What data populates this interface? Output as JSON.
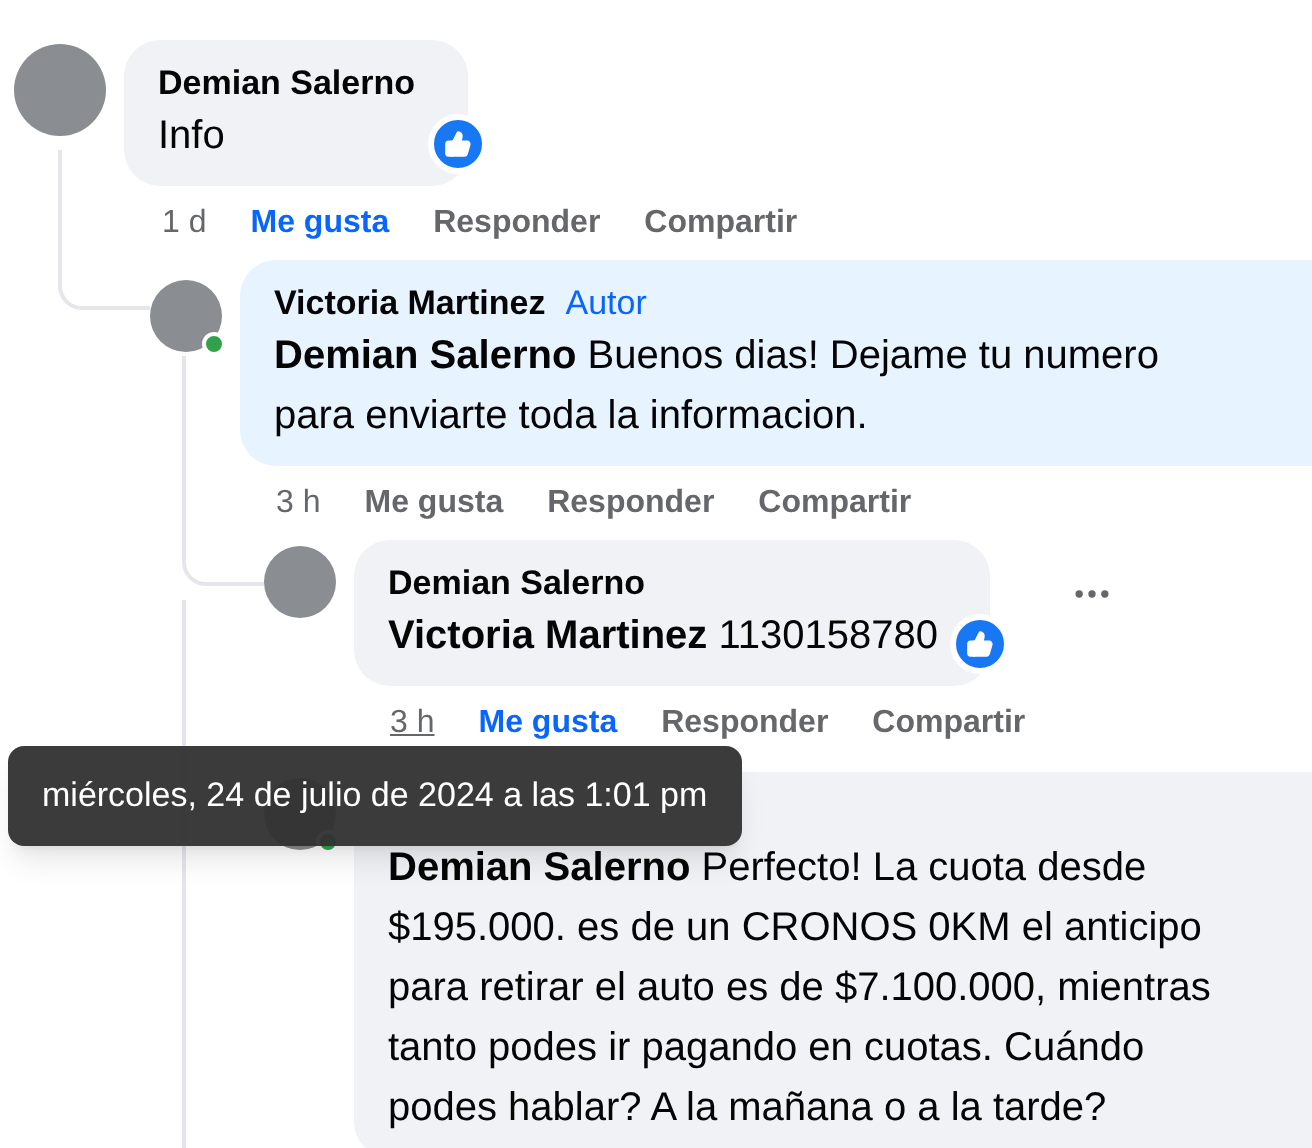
{
  "comments": [
    {
      "author": "Demian Salerno",
      "online": false,
      "text": "Info",
      "reacted": true,
      "time": "1 d",
      "time_hovered": false,
      "liked": true,
      "actions": [
        "Me gusta",
        "Responder",
        "Compartir"
      ],
      "more_visible": false,
      "children": [
        {
          "author": "Victoria Martinez",
          "author_tag": "Autor",
          "online": true,
          "mention": "Demian Salerno",
          "text": "Buenos dias! Dejame tu numero para enviarte toda la informacion.",
          "reacted": false,
          "time": "3 h",
          "time_hovered": false,
          "liked": false,
          "actions": [
            "Me gusta",
            "Responder",
            "Compartir"
          ],
          "more_visible": false,
          "children": [
            {
              "author": "Demian Salerno",
              "online": false,
              "mention": "Victoria Martinez",
              "text": "1130158780",
              "reacted": true,
              "time": "3 h",
              "time_hovered": true,
              "liked": true,
              "actions": [
                "Me gusta",
                "Responder",
                "Compartir"
              ],
              "more_visible": true
            },
            {
              "online": true,
              "mention": "Demian Salerno",
              "text": "Perfecto! La cuota desde $195.000. es de un CRONOS 0KM el anticipo para retirar el auto es de $7.100.000, mientras tanto podes ir pagando en cuotas. Cuándo podes hablar? A la mañana o a la tarde?",
              "reacted": false
            }
          ]
        }
      ]
    }
  ],
  "tooltip": {
    "text": "miércoles, 24 de julio de 2024 a las 1:01 pm"
  }
}
